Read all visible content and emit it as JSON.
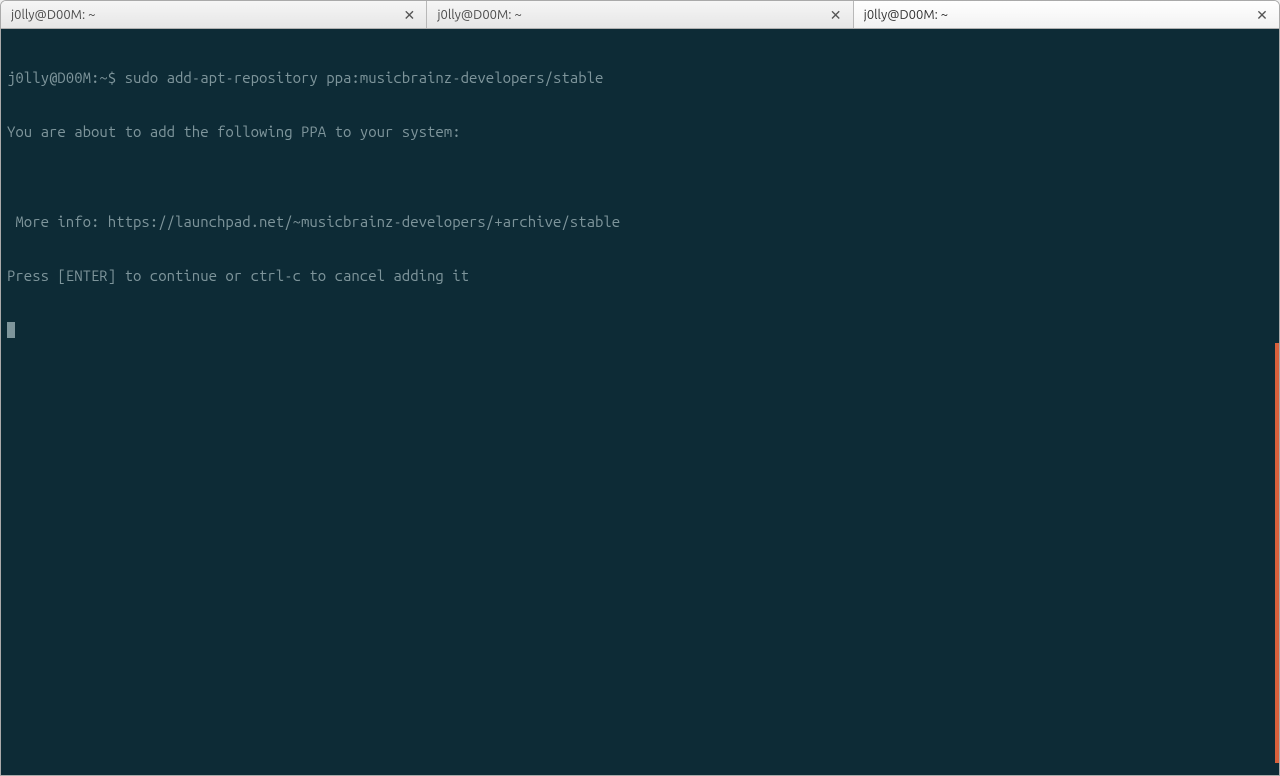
{
  "tabs": [
    {
      "label": "j0lly@D00M: ~",
      "active": false
    },
    {
      "label": "j0lly@D00M: ~",
      "active": false
    },
    {
      "label": "j0lly@D00M: ~",
      "active": true
    }
  ],
  "terminal": {
    "prompt": "j0lly@D00M:~$ ",
    "command": "sudo add-apt-repository ppa:musicbrainz-developers/stable",
    "lines": [
      "You are about to add the following PPA to your system:",
      "",
      " More info: https://launchpad.net/~musicbrainz-developers/+archive/stable",
      "Press [ENTER] to continue or ctrl-c to cancel adding it"
    ]
  }
}
